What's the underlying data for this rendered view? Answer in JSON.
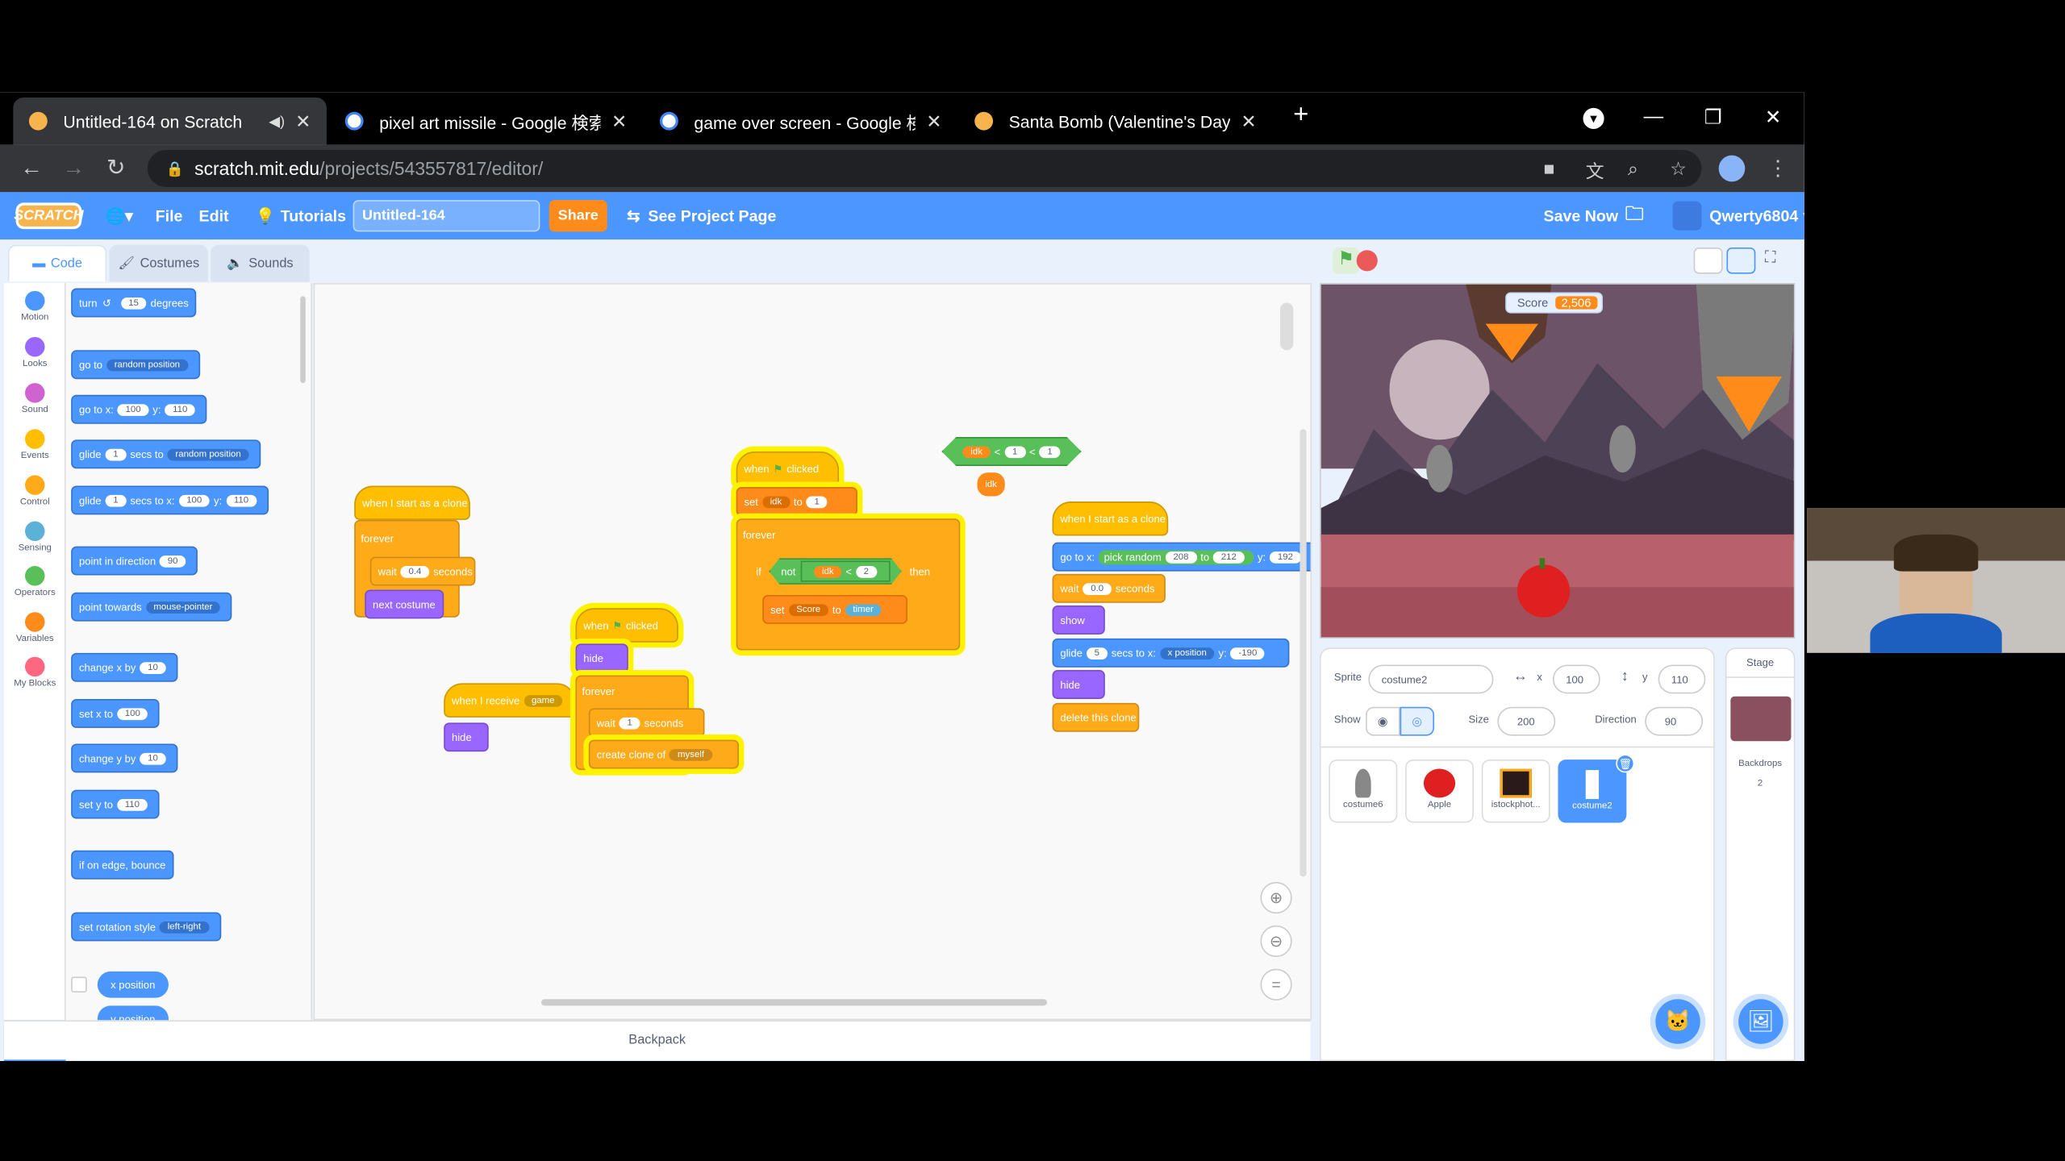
{
  "browser": {
    "tabs": [
      {
        "title": "Untitled-164 on Scratch",
        "active": true,
        "favicon": "scratch-favicon",
        "muted_icon": "speaker-icon"
      },
      {
        "title": "pixel art missile - Google 検索",
        "active": false,
        "favicon": "google-favicon"
      },
      {
        "title": "game over screen - Google 検索",
        "active": false,
        "favicon": "google-favicon"
      },
      {
        "title": "Santa Bomb (Valentine's Day Upd",
        "active": false,
        "favicon": "scratch-favicon"
      }
    ],
    "new_tab": "+",
    "url_host": "scratch.mit.edu",
    "url_path": "/projects/543557817/editor/"
  },
  "menubar": {
    "logo": "SCRATCH",
    "file": "File",
    "edit": "Edit",
    "tutorials": "Tutorials",
    "project_title": "Untitled-164",
    "share": "Share",
    "see_project_page": "See Project Page",
    "save_now": "Save Now",
    "username": "Qwerty6804"
  },
  "editor_tabs": {
    "code": "Code",
    "costumes": "Costumes",
    "sounds": "Sounds"
  },
  "categories": [
    {
      "label": "Motion",
      "color": "#4c97ff"
    },
    {
      "label": "Looks",
      "color": "#9966ff"
    },
    {
      "label": "Sound",
      "color": "#cf63cf"
    },
    {
      "label": "Events",
      "color": "#ffbf00"
    },
    {
      "label": "Control",
      "color": "#ffab19"
    },
    {
      "label": "Sensing",
      "color": "#5cb1d6"
    },
    {
      "label": "Operators",
      "color": "#59c059"
    },
    {
      "label": "Variables",
      "color": "#ff8c1a"
    },
    {
      "label": "My Blocks",
      "color": "#ff6680"
    }
  ],
  "palette": {
    "turn": {
      "a": "turn",
      "v": "15",
      "b": "degrees"
    },
    "goto": {
      "a": "go to",
      "dd": "random position"
    },
    "gotoxy": {
      "a": "go to x:",
      "x": "100",
      "y_label": "y:",
      "y": "110"
    },
    "glide1": {
      "a": "glide",
      "v": "1",
      "b": "secs to",
      "dd": "random position"
    },
    "glide2": {
      "a": "glide",
      "v": "1",
      "b": "secs to x:",
      "x": "100",
      "y_label": "y:",
      "y": "110"
    },
    "point_dir": {
      "a": "point in direction",
      "v": "90"
    },
    "point_towards": {
      "a": "point towards",
      "dd": "mouse-pointer"
    },
    "change_x": {
      "a": "change x by",
      "v": "10"
    },
    "set_x": {
      "a": "set x to",
      "v": "100"
    },
    "change_y": {
      "a": "change y by",
      "v": "10"
    },
    "set_y": {
      "a": "set y to",
      "v": "110"
    },
    "bounce": "if on edge, bounce",
    "rotation": {
      "a": "set rotation style",
      "dd": "left-right"
    },
    "xpos": "x position",
    "ypos": "y position"
  },
  "scripts": {
    "clone1": {
      "hat": "when I start as a clone",
      "forever": "forever",
      "wait": "wait",
      "wait_v": "0.4",
      "seconds": "seconds",
      "next": "next costume"
    },
    "receive": {
      "hat": "when I receive",
      "msg": "game",
      "hide": "hide"
    },
    "flag1": {
      "when": "when",
      "clicked": "clicked",
      "hide": "hide",
      "forever": "forever",
      "wait": "wait",
      "wait_v": "1",
      "seconds": "seconds",
      "create": "create clone of",
      "myself": "myself"
    },
    "flag2": {
      "when": "when",
      "clicked": "clicked",
      "set": "set",
      "var": "idk",
      "to": "to",
      "val": "1",
      "forever": "forever",
      "if": "if",
      "not": "not",
      "idk": "idk",
      "lt": "<",
      "two": "2",
      "then": "then",
      "set2": "set",
      "score": "Score",
      "to2": "to",
      "timer": "timer"
    },
    "floating": {
      "idk": "idk",
      "lt": "<",
      "one": "1",
      "lt2": "<",
      "one2": "1",
      "idk2": "idk"
    },
    "clone2": {
      "hat": "when I start as a clone",
      "goto": "go to x:",
      "pick": "pick random",
      "from": "208",
      "to": "to",
      "upto": "212",
      "y_label": "y:",
      "y": "192",
      "wait": "wait",
      "wait_v": "0.0",
      "seconds": "seconds",
      "show": "show",
      "glide": "glide",
      "glide_v": "5",
      "secs_to_x": "secs to x:",
      "xpos": "x position",
      "y_label2": "y:",
      "glide_y": "-190",
      "hide": "hide",
      "delete": "delete this clone"
    }
  },
  "backpack": "Backpack",
  "stage": {
    "score_label": "Score",
    "score_value": "2,506"
  },
  "sprite_info": {
    "sprite_label": "Sprite",
    "sprite_name": "costume2",
    "x_label": "x",
    "x": "100",
    "y_label": "y",
    "y": "110",
    "show_label": "Show",
    "size_label": "Size",
    "size": "200",
    "direction_label": "Direction",
    "direction": "90"
  },
  "sprites": [
    {
      "name": "costume6",
      "selected": false
    },
    {
      "name": "Apple",
      "selected": false
    },
    {
      "name": "istockphot...",
      "selected": false
    },
    {
      "name": "costume2",
      "selected": true
    }
  ],
  "stage_pane": {
    "title": "Stage",
    "backdrops_label": "Backdrops",
    "backdrops_count": "2"
  }
}
